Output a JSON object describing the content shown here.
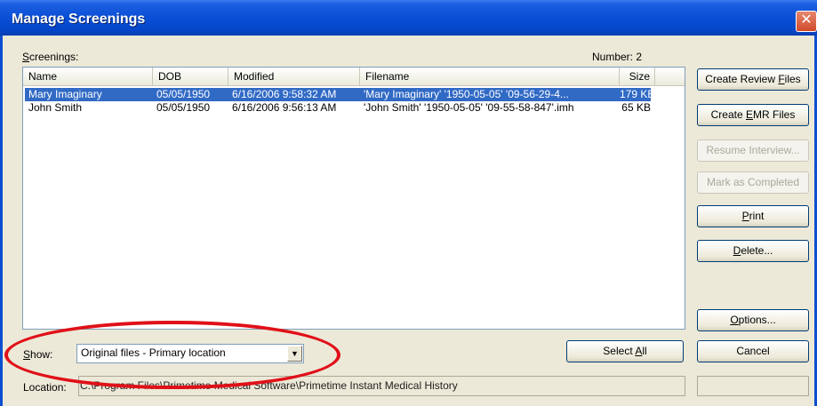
{
  "window": {
    "title": "Manage Screenings",
    "close_glyph": "✕"
  },
  "screenings": {
    "label": "Screenings:",
    "number_text": "Number: 2"
  },
  "table": {
    "headers": {
      "name": "Name",
      "dob": "DOB",
      "modified": "Modified",
      "filename": "Filename",
      "size": "Size"
    },
    "rows": [
      {
        "name": "Mary Imaginary",
        "dob": "05/05/1950",
        "modified": "6/16/2006 9:58:32 AM",
        "filename": "'Mary Imaginary' '1950-05-05' '09-56-29-4...",
        "size": "179 KB",
        "selected": true
      },
      {
        "name": "John Smith",
        "dob": "05/05/1950",
        "modified": "6/16/2006 9:56:13 AM",
        "filename": "'John Smith' '1950-05-05' '09-55-58-847'.imh",
        "size": "65 KB",
        "selected": false
      }
    ]
  },
  "buttons": {
    "create_review": "Create Review Files",
    "create_emr": "Create EMR Files",
    "resume": "Resume Interview...",
    "mark_completed": "Mark as Completed",
    "print": "Print",
    "delete": "Delete...",
    "options": "Options...",
    "cancel": "Cancel",
    "select_all": "Select All"
  },
  "show": {
    "label": "Show:",
    "value": "Original files - Primary location",
    "dropdown_icon": "▼"
  },
  "location": {
    "label": "Location:",
    "value": "C:\\Program Files\\Primetime Medical Software\\Primetime Instant Medical History"
  },
  "annotation": {
    "color": "#e01018"
  }
}
